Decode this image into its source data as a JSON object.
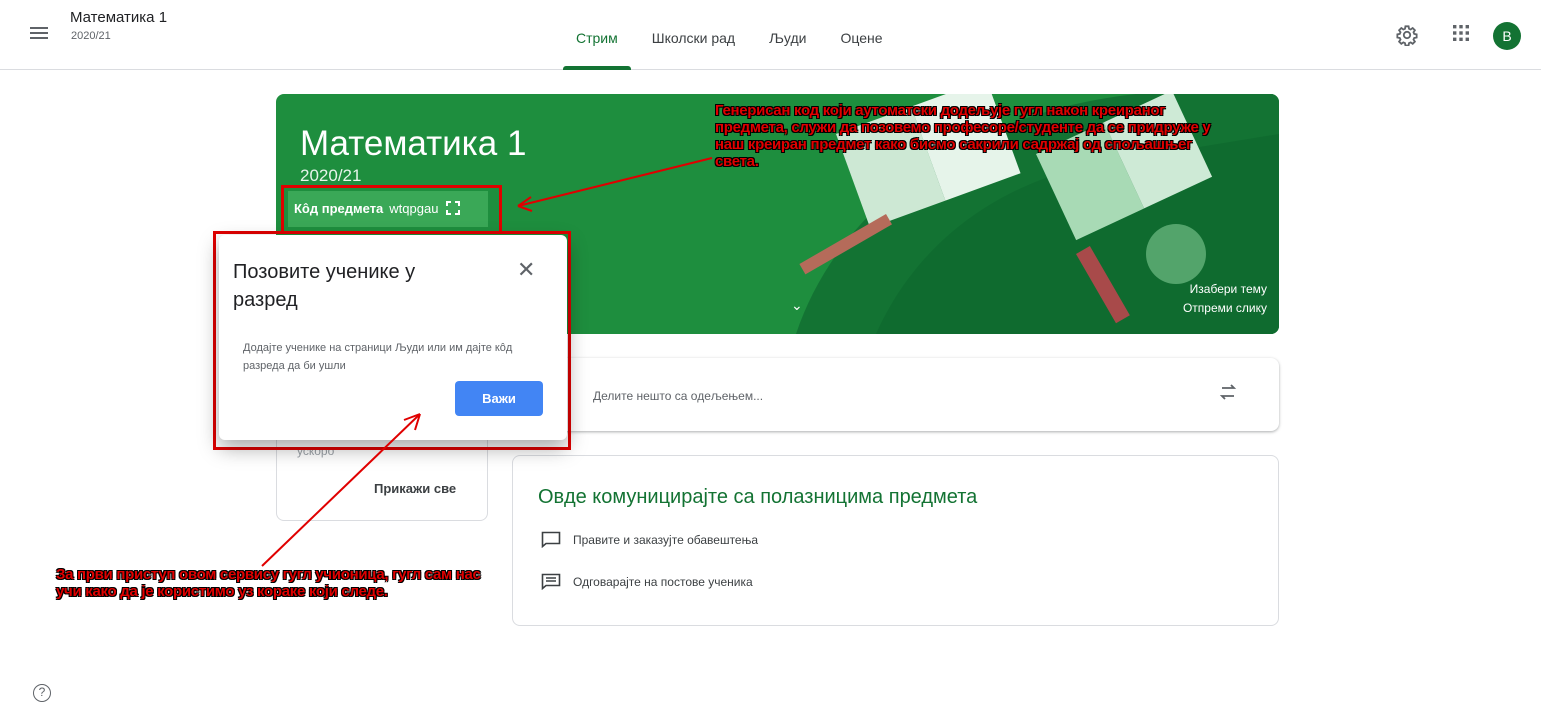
{
  "header": {
    "class_name": "Математика 1",
    "class_year": "2020/21",
    "tabs": [
      {
        "label": "Стрим"
      },
      {
        "label": "Школски рад"
      },
      {
        "label": "Људи"
      },
      {
        "label": "Оцене"
      }
    ],
    "active_tab": "Стрим",
    "avatar_letter": "B",
    "icons": [
      "menu-icon",
      "settings-icon",
      "apps-grid-icon"
    ]
  },
  "banner": {
    "title": "Математика 1",
    "subtitle": "2020/21",
    "code_label": "Кôд предмета",
    "code_value": "wtqpgau",
    "choose_theme": "Изабери тему",
    "upload_photo": "Отпреми слику",
    "color": "#1e8e3e"
  },
  "upcoming": {
    "soon_text": "ускоро",
    "view_all": "Прикажи све"
  },
  "share": {
    "placeholder": "Делите нешто са одељењем..."
  },
  "communicate": {
    "title": "Овде комуницирајте са полазницима предмета",
    "items": [
      {
        "label": "Правите и заказујте обавештења",
        "icon": "announcement-icon"
      },
      {
        "label": "Одговарајте на постове ученика",
        "icon": "message-icon"
      }
    ]
  },
  "dialog": {
    "title": "Позовите ученике у разред",
    "body": "Додајте ученике на страници Људи или им дајте кôд разреда да би ушли",
    "button": "Важи"
  },
  "annotations": {
    "code_note": "Генерисан код који аутоматски додељује гугл након креираног предмета, служи да позовемо професоре/студенте да се придруже у наш креиран предмет како бисмо сакрили садржај од спољашњег света.",
    "first_access_note": "За први приступ овом сервису гугл учионица, гугл сам нас учи како да је користимо уз кораке који следе."
  },
  "colors": {
    "accent": "#137333",
    "annotation": "#e00000",
    "button": "#4285f4"
  }
}
